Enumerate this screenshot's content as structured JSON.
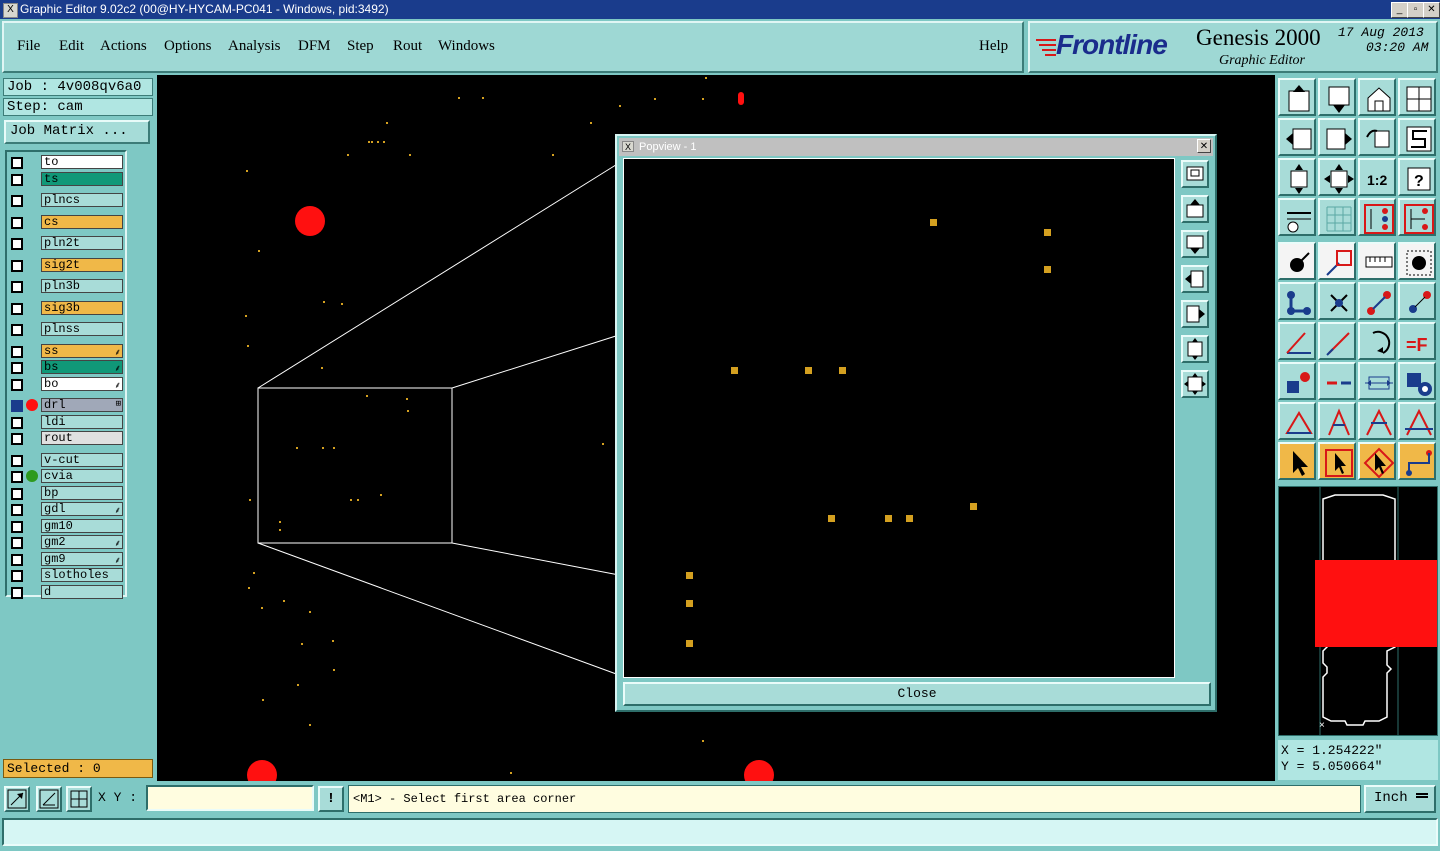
{
  "window": {
    "title": "Graphic Editor 9.02c2 (00@HY-HYCAM-PC041 - Windows, pid:3492)",
    "min": "_",
    "max": "▫",
    "close": "✕"
  },
  "menu": {
    "items": [
      "File",
      "Edit",
      "Actions",
      "Options",
      "Analysis",
      "DFM",
      "Step",
      "Rout",
      "Windows"
    ],
    "help": "Help"
  },
  "brand": {
    "logo": "Frontline",
    "product": "Genesis 2000",
    "subtitle": "Graphic Editor",
    "date": "17 Aug 2013",
    "time": "03:20 AM"
  },
  "job": {
    "job_line": "Job : 4v008qv6a0",
    "step_line": "Step: cam",
    "matrix_btn": "Job Matrix ..."
  },
  "layers": [
    {
      "name": "to",
      "color": "#ffffff",
      "ext": ""
    },
    {
      "name": "ts",
      "color": "#109878",
      "ext": ""
    },
    {
      "name": "plncs",
      "color": "#a8dcd8",
      "ext": ""
    },
    {
      "name": "cs",
      "color": "#f0b848",
      "ext": ""
    },
    {
      "name": "pln2t",
      "color": "#a8dcd8",
      "ext": ""
    },
    {
      "name": "sig2t",
      "color": "#f0b848",
      "ext": ""
    },
    {
      "name": "pln3b",
      "color": "#a8dcd8",
      "ext": ""
    },
    {
      "name": "sig3b",
      "color": "#f0b848",
      "ext": ""
    },
    {
      "name": "plnss",
      "color": "#a8dcd8",
      "ext": ""
    },
    {
      "name": "ss",
      "color": "#f0b848",
      "ext": "⸙"
    },
    {
      "name": "bs",
      "color": "#109878",
      "ext": "⸙"
    },
    {
      "name": "bo",
      "color": "#ffffff",
      "ext": "⸙"
    },
    {
      "name": "drl",
      "color": "#a0a8b8",
      "ext": "⊞"
    },
    {
      "name": "ldi",
      "color": "#a8dcd8",
      "ext": ""
    },
    {
      "name": "rout",
      "color": "#e0e0e0",
      "ext": ""
    },
    {
      "name": "v-cut",
      "color": "#a8dcd8",
      "ext": ""
    },
    {
      "name": "cvia",
      "color": "#a8dcd8",
      "ext": ""
    },
    {
      "name": "bp",
      "color": "#a8dcd8",
      "ext": ""
    },
    {
      "name": "gdl",
      "color": "#a8dcd8",
      "ext": "⸙"
    },
    {
      "name": "gm10",
      "color": "#a8dcd8",
      "ext": ""
    },
    {
      "name": "gm2",
      "color": "#a8dcd8",
      "ext": "⸙"
    },
    {
      "name": "gm9",
      "color": "#a8dcd8",
      "ext": "⸙"
    },
    {
      "name": "slotholes",
      "color": "#a8dcd8",
      "ext": ""
    },
    {
      "name": "d",
      "color": "#a8dcd8",
      "ext": ""
    }
  ],
  "selected": "Selected : 0",
  "popview": {
    "title": "Popview - 1",
    "close": "Close"
  },
  "coords": {
    "x": "X = 1.254222\"",
    "y": "Y = 5.050664\""
  },
  "bottom": {
    "xy_label": "X Y :",
    "xy_value": "",
    "bang": "!",
    "message": "<M1> - Select first area corner",
    "unit": "Inch"
  },
  "tool_icons": [
    "sub-menu-up-icon",
    "sub-menu-down-icon",
    "home-icon",
    "split-view-icon",
    "pan-left-icon",
    "pan-right-icon",
    "undo-view-icon",
    "redraw-icon",
    "zoom-fit-vertical-icon",
    "zoom-fit-icon",
    "zoom-1to2-icon",
    "help-icon",
    "settings-icon",
    "grid-icon",
    "layer-compare-icon",
    "layer-compare-2-icon",
    "pad-add-icon",
    "line-color-icon",
    "ruler-icon",
    "dot-icon",
    "connect-icon",
    "delete-icon",
    "move-icon",
    "copy-icon",
    "angle-icon",
    "line-icon",
    "rotate-icon",
    "text-icon",
    "pad-select-icon",
    "line-cut-icon",
    "measure-icon",
    "shape-icon",
    "triangle-icon",
    "triangle-a-icon",
    "triangle-b-icon",
    "triangle-c-icon",
    "pointer-icon",
    "pointer-box-icon",
    "pointer-highlight-icon",
    "net-select-icon"
  ]
}
